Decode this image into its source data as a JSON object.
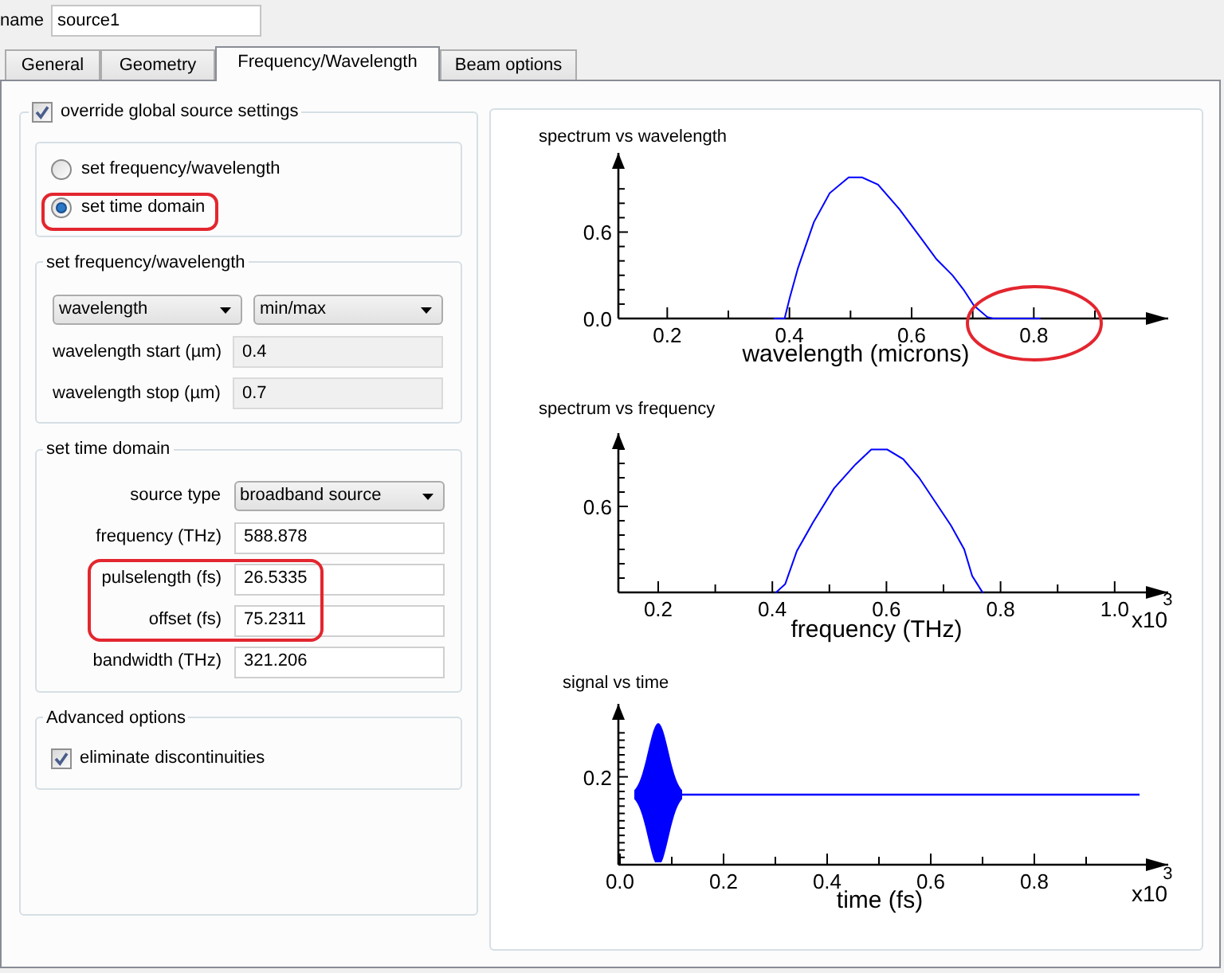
{
  "name_field": {
    "label": "name",
    "value": "source1"
  },
  "tabs": [
    {
      "label": "General",
      "selected": false
    },
    {
      "label": "Geometry",
      "selected": false
    },
    {
      "label": "Frequency/Wavelength",
      "selected": true
    },
    {
      "label": "Beam options",
      "selected": false
    }
  ],
  "override_group": {
    "label": "override global source settings",
    "checked": true
  },
  "source_mode": [
    {
      "label": "set frequency/wavelength",
      "selected": false,
      "highlighted": false
    },
    {
      "label": "set time domain",
      "selected": true,
      "highlighted": true
    }
  ],
  "frequency_group": {
    "title": "set frequency/wavelength",
    "dropdowns": [
      "wavelength",
      "min/max"
    ],
    "fields": [
      {
        "label": "wavelength start (µm)",
        "value": "0.4",
        "disabled": true
      },
      {
        "label": "wavelength stop (µm)",
        "value": "0.7",
        "disabled": true
      }
    ]
  },
  "time_domain": {
    "title": "set time domain",
    "source_type": {
      "label": "source type",
      "value": "broadband source"
    },
    "fields": [
      {
        "label": "frequency (THz)",
        "value": "588.878",
        "disabled": false,
        "highlighted": false
      },
      {
        "label": "pulselength (fs)",
        "value": "26.5335",
        "disabled": false,
        "highlighted": true
      },
      {
        "label": "offset (fs)",
        "value": "75.2311",
        "disabled": false,
        "highlighted": true
      },
      {
        "label": "bandwidth (THz)",
        "value": "321.206",
        "disabled": false,
        "highlighted": false
      }
    ]
  },
  "advanced": {
    "title": "Advanced options",
    "checkbox": {
      "label": "eliminate discontinuities",
      "checked": true
    }
  },
  "plots": [
    {
      "kind": "chart",
      "ellipse_highlight": true,
      "chart_data": {
        "type": "line",
        "title": "spectrum vs wavelength",
        "xlabel": "wavelength (microns)",
        "x": [
          0.374,
          0.392,
          0.401,
          0.414,
          0.44,
          0.466,
          0.497,
          0.519,
          0.545,
          0.58,
          0.615,
          0.641,
          0.667,
          0.685,
          0.702,
          0.724,
          0.733,
          0.811
        ],
        "series": [
          {
            "color": "#0000ff",
            "values": [
              0,
              0,
              0.15,
              0.35,
              0.67,
              0.87,
              0.98,
              0.98,
              0.93,
              0.76,
              0.56,
              0.41,
              0.3,
              0.2,
              0.09,
              0.01,
              0,
              0
            ]
          }
        ],
        "xlim": [
          0.12,
          1.02
        ],
        "ylim": [
          0,
          1.15
        ],
        "xticks": [
          0.2,
          0.4,
          0.6,
          0.8
        ],
        "yticks": [
          {
            "value": 0,
            "label": "0.0"
          },
          0.6
        ]
      }
    },
    {
      "kind": "spectrum",
      "title": "spectrum vs frequency",
      "xlabel": "frequency (THz)",
      "x_tick_labels": [
        "0.2",
        "0.4",
        "0.6",
        "0.8",
        "1.0"
      ],
      "y_tick_labels": [
        "0.6"
      ],
      "multiplier": "x10",
      "exponent": "3"
    },
    {
      "kind": "signal",
      "title": "signal vs time",
      "xlabel": "time (fs)",
      "x_tick_labels": [
        "0.0",
        "0.2",
        "0.4",
        "0.6",
        "0.8"
      ],
      "y_tick_labels": [
        "0.2"
      ],
      "multiplier": "x10",
      "exponent": "3"
    }
  ]
}
